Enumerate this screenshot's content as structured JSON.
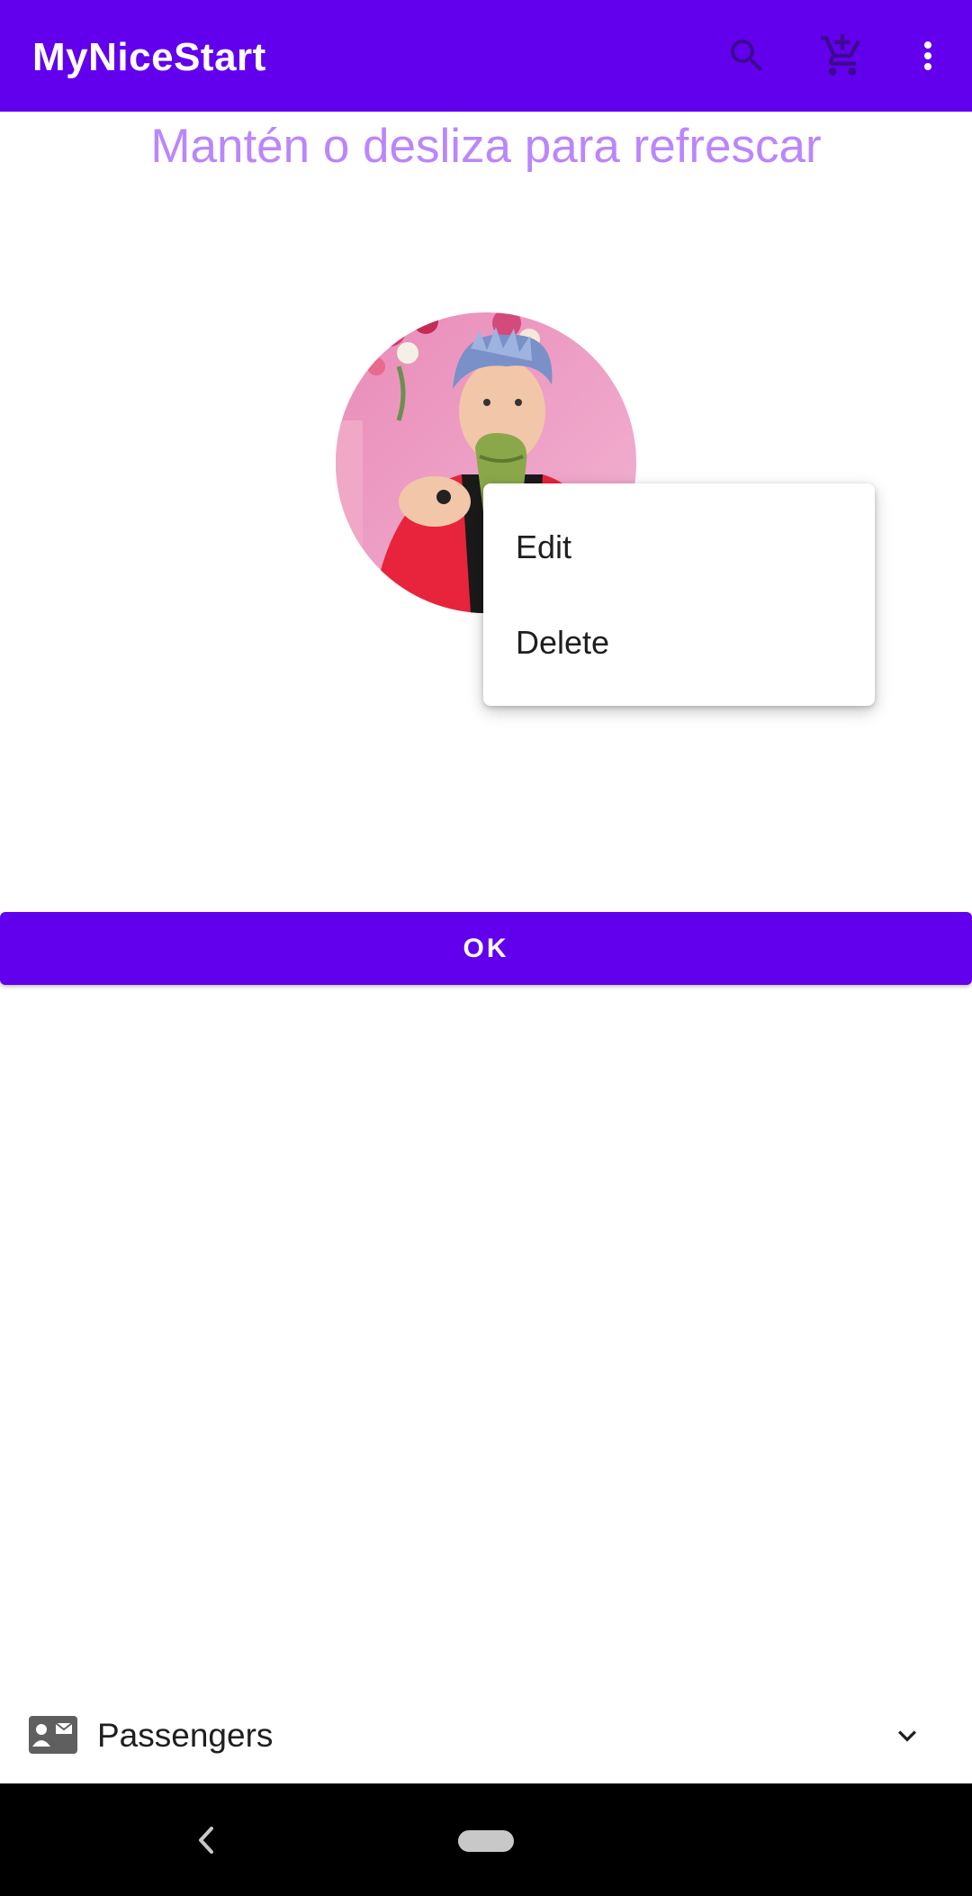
{
  "app_bar": {
    "title": "MyNiceStart",
    "background_color": "#6200ee",
    "actions": [
      {
        "icon": "search-icon"
      },
      {
        "icon": "add-shopping-cart-icon"
      },
      {
        "icon": "more-vert-icon"
      }
    ]
  },
  "main": {
    "refresh_hint": "Mantén o desliza para refrescar",
    "refresh_hint_color": "#bb86fc",
    "avatar": {
      "icon": "profile-photo"
    },
    "ok_button_label": "OK"
  },
  "context_menu": {
    "items": [
      {
        "label": "Edit"
      },
      {
        "label": "Delete"
      }
    ]
  },
  "bottom_bar": {
    "label": "Passengers",
    "icon": "contact-mail-icon",
    "chevron": "chevron-down-icon"
  },
  "system_nav": {
    "back": "back-icon",
    "home": "home-pill"
  }
}
